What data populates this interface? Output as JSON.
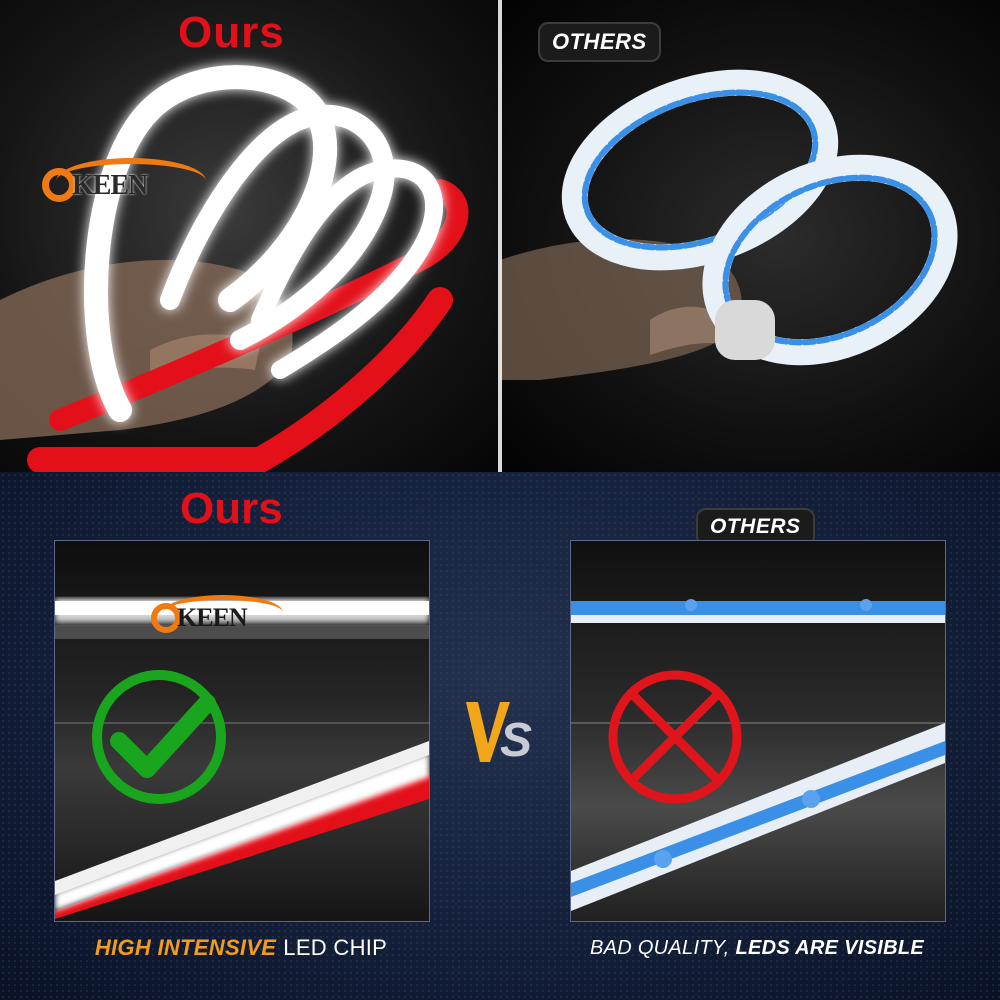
{
  "top_left": {
    "label": "Ours"
  },
  "top_right": {
    "label": "OTHERS"
  },
  "logo": {
    "text": "KEEN"
  },
  "bottom_left": {
    "label": "Ours",
    "caption_highlight": "HIGH INTENSIVE",
    "caption_rest": "LED CHIP"
  },
  "bottom_right": {
    "label": "OTHERS",
    "caption_lead": "BAD QUALITY,",
    "caption_rest": "LEDS ARE VISIBLE"
  },
  "vs": {
    "v": "V",
    "s": "S"
  },
  "icons": {
    "good": "check-icon",
    "bad": "cross-icon"
  },
  "colors": {
    "ours_red": "#e3101a",
    "accent_orange": "#f07a12",
    "check_green": "#19a51e",
    "cross_red": "#e0151b",
    "led_blue": "#3a8fe6"
  }
}
